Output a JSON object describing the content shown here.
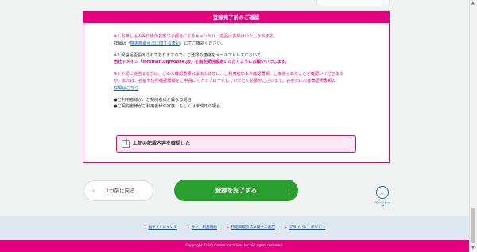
{
  "notice": {
    "header": "登録完了前のご確認",
    "item1_line1": "※1 お申し込み受付後のお客さま都合によるキャンセル、返品はお受けいたしかねます。",
    "item1_line2_pre": "詳細は「",
    "item1_line2_link": "特定商取引法に関する表記",
    "item1_line2_post": "」にてご確認ください。",
    "item2_line1": "※2 受信拒否設定されておりますので、ご登録の連絡をメールアドレスにおいて、",
    "item2_line2": "当社ドメイン「infomail.uqmobile.jp」を指定受信設定いただくようにお願いいたします。",
    "item3_line1": "※3 下記に該当する方は、ご本人確認書類の提出のほかに、ご利用者の本人確認書類、ご家族であることを確認いただきます",
    "item3_line2": "か、または、名前や住所確認書類をご申請にてアップロードしていただく必要がございます。お手元にお客様証明書類の",
    "item3_line3_link": "詳細はこちら",
    "bullet1": "●ご利用者様が、ご契約者様と異なる場合",
    "bullet2": "●ご契約者様がご利用者様の家族、もしくは未成年の場合"
  },
  "confirm": {
    "label": "上記の記載内容を確認した",
    "checked": false
  },
  "buttons": {
    "back_arrow": "‹",
    "back_label": "1つ前に戻る",
    "submit_label": "登録を完了する",
    "submit_arrow": "›"
  },
  "pagetop": {
    "arrow": "︿",
    "label": "ページトップ"
  },
  "footer": {
    "links": [
      "当サイトについて",
      "サイト利用規約",
      "特定商取引法に関する表記",
      "プライバシーポリシー"
    ],
    "copyright": "Copyright © UQ Communications Inc. All rights reserved."
  },
  "colors": {
    "brand_pink": "#e4007f",
    "submit_green": "#2a9f2f",
    "footer_blue": "#dde8f1"
  }
}
